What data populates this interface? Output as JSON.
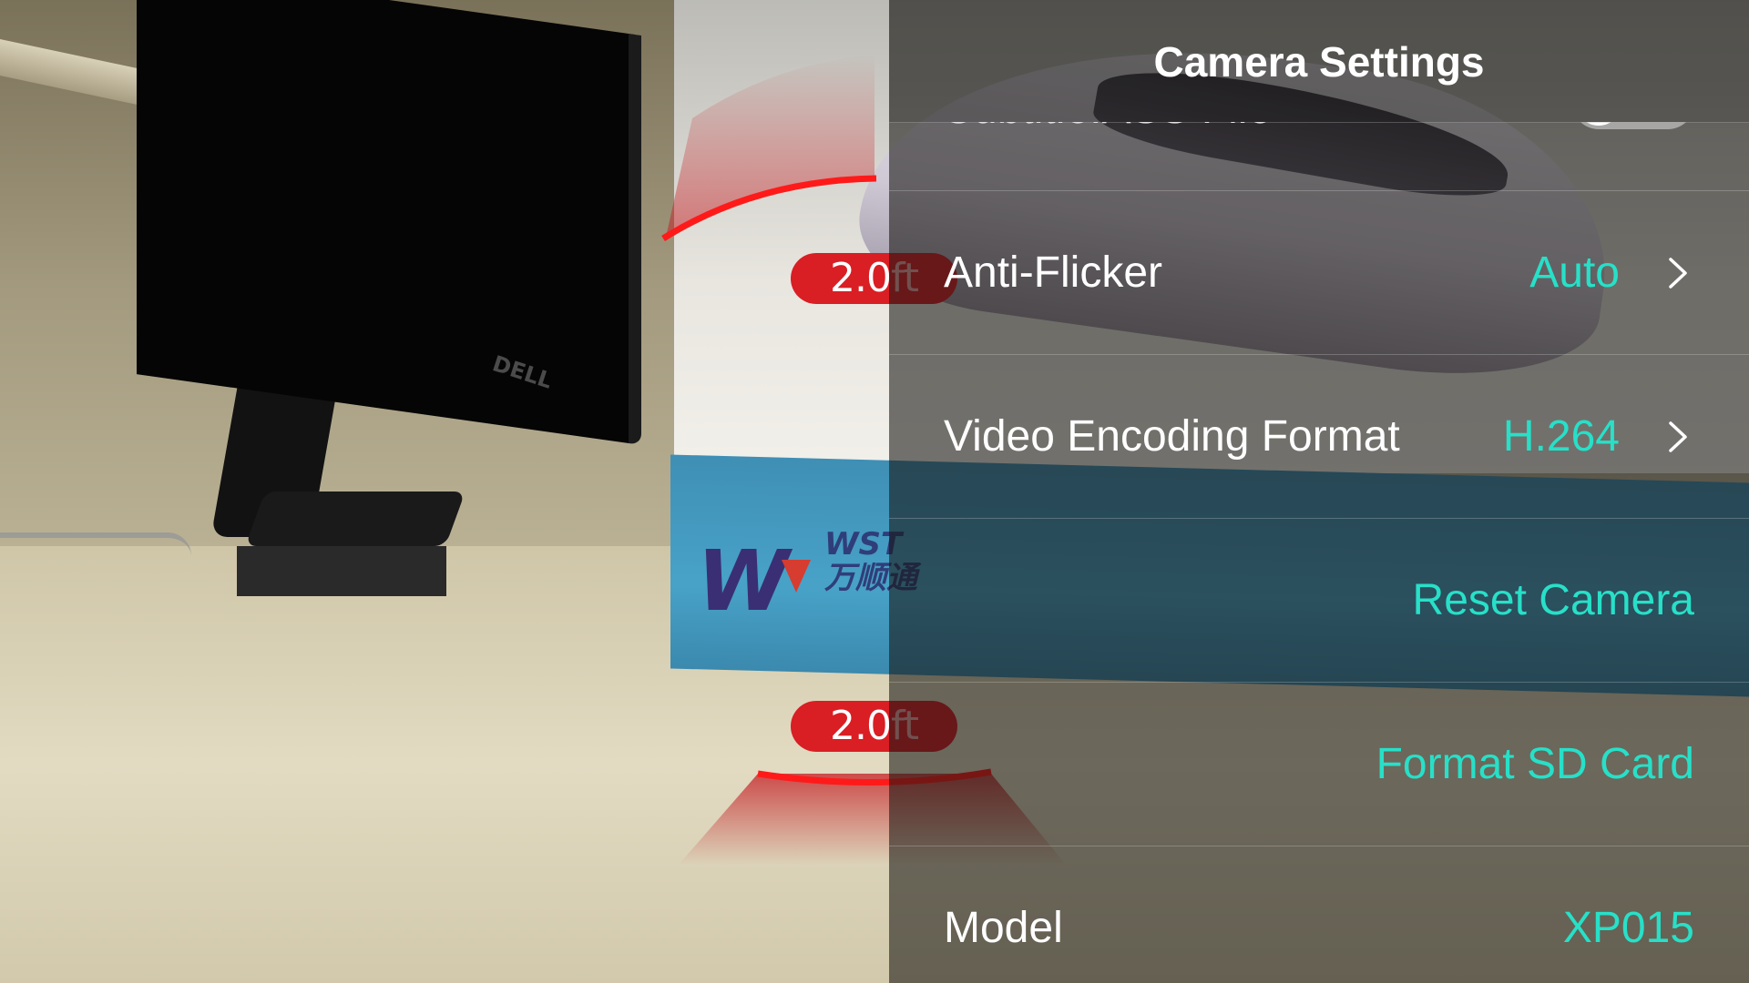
{
  "header": {
    "title": "Camera Settings"
  },
  "distance_guide": {
    "top_value": "2.0",
    "top_unit": "ft",
    "bottom_value": "2.0",
    "bottom_unit": "ft",
    "color": "#d91e24"
  },
  "settings": {
    "subtitle_ass": {
      "label": "Subtitle.ASS File",
      "enabled": false
    },
    "anti_flicker": {
      "label": "Anti-Flicker",
      "value": "Auto"
    },
    "video_encoding": {
      "label": "Video Encoding Format",
      "value": "H.264"
    },
    "reset_camera": {
      "label": "Reset Camera"
    },
    "format_sd": {
      "label": "Format SD Card"
    },
    "model": {
      "label": "Model",
      "value": "XP015"
    }
  },
  "background": {
    "monitor_logo": "DELL",
    "book_brand_latin": "WST",
    "book_brand_cn": "万顺通"
  },
  "colors": {
    "accent": "#27e0c8",
    "guide_red": "#d91e24",
    "text": "#ffffff"
  },
  "icons": {
    "chevron": "chevron-right-icon"
  }
}
